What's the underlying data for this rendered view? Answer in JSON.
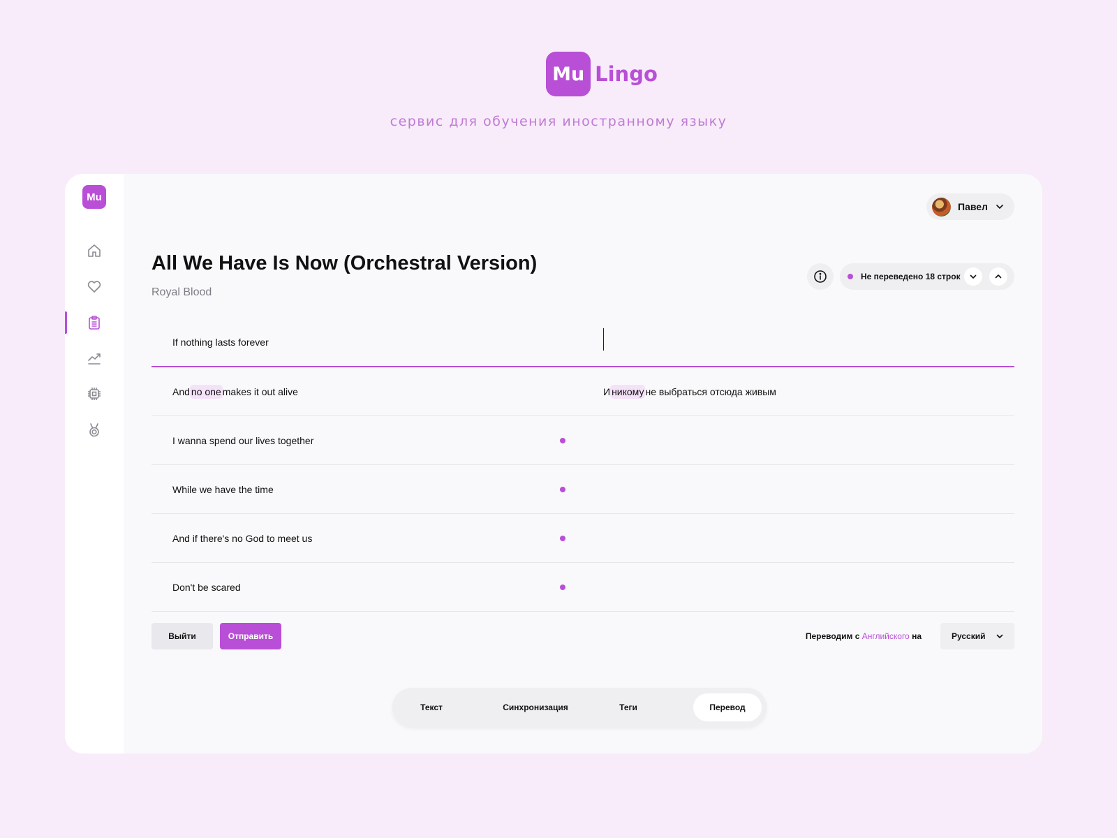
{
  "brand": {
    "logo_text": "Mu",
    "name": "Lingo",
    "tagline": "сервис для обучения иностранному языку",
    "accent_color": "#b84fd6"
  },
  "sidebar": {
    "logo": "Mu",
    "items": [
      {
        "icon": "home-icon",
        "active": false
      },
      {
        "icon": "heart-icon",
        "active": false
      },
      {
        "icon": "clipboard-icon",
        "active": true
      },
      {
        "icon": "trending-chart-icon",
        "active": false
      },
      {
        "icon": "chip-icon",
        "active": false
      },
      {
        "icon": "medal-icon",
        "active": false
      }
    ]
  },
  "user": {
    "name": "Павел",
    "avatar_icon": "user-avatar"
  },
  "song": {
    "title": "All We Have Is Now (Orchestral Version)",
    "artist": "Royal Blood"
  },
  "status": {
    "text": "Не переведено 18 строк",
    "untranslated_count": 18
  },
  "rows": [
    {
      "original": "If nothing lasts forever",
      "translation": "",
      "active": true
    },
    {
      "original_parts": [
        "And ",
        "no one",
        " makes it out alive"
      ],
      "translation_parts": [
        "И ",
        "никому",
        " не выбраться отсюда живым"
      ]
    },
    {
      "original": "I wanna spend our lives together",
      "translation": "",
      "pending": true
    },
    {
      "original": "While we have the time",
      "translation": "",
      "pending": true
    },
    {
      "original": "And if there's no God to meet us",
      "translation": "",
      "pending": true
    },
    {
      "original": "Don't be scared",
      "translation": "",
      "pending": true
    }
  ],
  "actions": {
    "exit_label": "Выйти",
    "send_label": "Отправить"
  },
  "language": {
    "prefix": "Переводим с ",
    "source": "Английского",
    "suffix": " на",
    "target": "Русский"
  },
  "tabs": [
    {
      "label": "Текст",
      "selected": false
    },
    {
      "label": "Синхронизация",
      "selected": false
    },
    {
      "label": "Теги",
      "selected": false
    },
    {
      "label": "Перевод",
      "selected": true
    }
  ]
}
